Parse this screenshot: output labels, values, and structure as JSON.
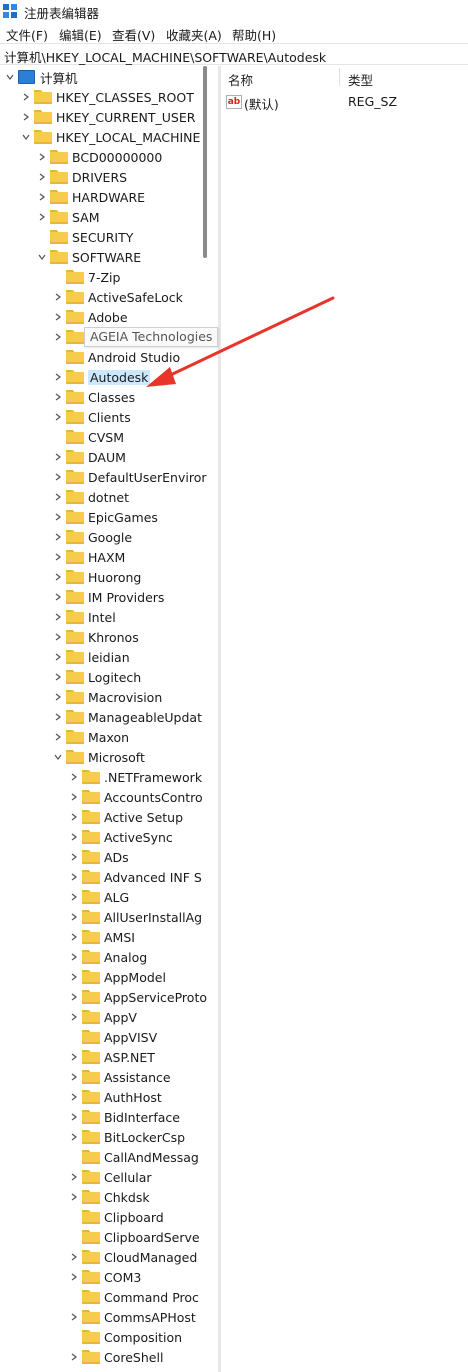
{
  "window": {
    "title": "注册表编辑器"
  },
  "menu": [
    "文件(F)",
    "编辑(E)",
    "查看(V)",
    "收藏夹(A)",
    "帮助(H)"
  ],
  "address": "计算机\\HKEY_LOCAL_MACHINE\\SOFTWARE\\Autodesk",
  "tree": {
    "root": "计算机",
    "hives": [
      "HKEY_CLASSES_ROOT",
      "HKEY_CURRENT_USER",
      "HKEY_LOCAL_MACHINE"
    ],
    "hklm_children": [
      "BCD00000000",
      "DRIVERS",
      "HARDWARE",
      "SAM",
      "SECURITY",
      "SOFTWARE"
    ],
    "software_children": [
      "7-Zip",
      "ActiveSafeLock",
      "Adobe",
      "AGEIA Technologies",
      "Android Studio",
      "Autodesk",
      "Classes",
      "Clients",
      "CVSM",
      "DAUM",
      "DefaultUserEnviror",
      "dotnet",
      "EpicGames",
      "Google",
      "HAXM",
      "Huorong",
      "IM Providers",
      "Intel",
      "Khronos",
      "leidian",
      "Logitech",
      "Macrovision",
      "ManageableUpdat",
      "Maxon",
      "Microsoft"
    ],
    "microsoft_children": [
      ".NETFramework",
      "AccountsContro",
      "Active Setup",
      "ActiveSync",
      "ADs",
      "Advanced INF S",
      "ALG",
      "AllUserInstallAg",
      "AMSI",
      "Analog",
      "AppModel",
      "AppServiceProto",
      "AppV",
      "AppVISV",
      "ASP.NET",
      "Assistance",
      "AuthHost",
      "BidInterface",
      "BitLockerCsp",
      "CallAndMessag",
      "Cellular",
      "Chkdsk",
      "Clipboard",
      "ClipboardServe",
      "CloudManaged",
      "COM3",
      "Command Proc",
      "CommsAPHost",
      "Composition",
      "CoreShell"
    ],
    "selected": "Autodesk",
    "tooltip": "AGEIA Technologies"
  },
  "values_pane": {
    "headers": {
      "name": "名称",
      "type": "类型"
    },
    "rows": [
      {
        "name": "(默认)",
        "type": "REG_SZ",
        "icon": "string-value-icon"
      }
    ]
  },
  "colors": {
    "folder": "#f7cc4d",
    "selection": "#cce8ff",
    "annotation_arrow": "#e8352a"
  }
}
